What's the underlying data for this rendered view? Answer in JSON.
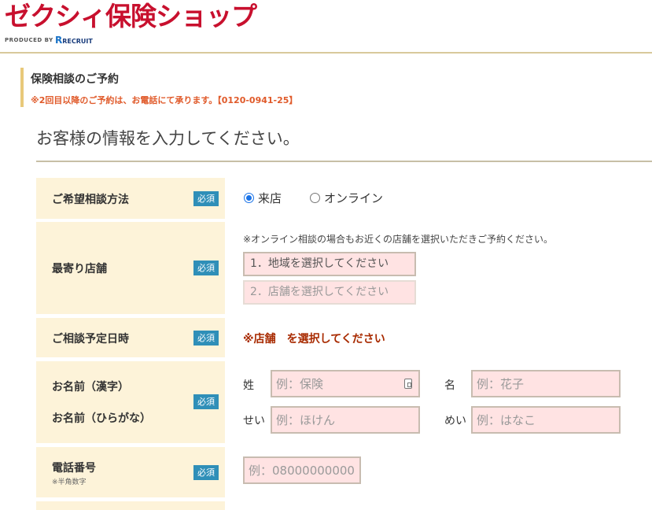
{
  "header": {
    "logo_text": "ゼクシィ保険ショップ",
    "produced_by": "PRODUCED BY",
    "recruit_mark": "R",
    "recruit_text": "RECRUIT"
  },
  "notice": {
    "title": "保険相談のご予約",
    "subtitle": "※2回目以降のご予約は、お電話にて承ります。【0120-0941-25】"
  },
  "section": {
    "title": "お客様の情報を入力してください。"
  },
  "required_label": "必須",
  "form": {
    "method": {
      "label": "ご希望相談方法",
      "options": [
        "来店",
        "オンライン"
      ],
      "selected": "来店"
    },
    "store": {
      "label": "最寄り店舗",
      "note": "※オンライン相談の場合もお近くの店舗を選択いただきご予約ください。",
      "area_select": "1．地域を選択してください",
      "store_select": "2．店舗を選択してください"
    },
    "datetime": {
      "label": "ご相談予定日時",
      "warning": "※店舗　を選択してください"
    },
    "name": {
      "label_kanji": "お名前（漢字）",
      "label_kana": "お名前（ひらがな）",
      "sei_label": "姓",
      "sei_placeholder": "例：保険",
      "mei_label": "名",
      "mei_placeholder": "例：花子",
      "sei_kana_label": "せい",
      "sei_kana_placeholder": "例：ほけん",
      "mei_kana_label": "めい",
      "mei_kana_placeholder": "例：はなこ"
    },
    "phone": {
      "label": "電話番号",
      "hint": "※半角数字",
      "placeholder": "例：08000000000"
    }
  },
  "colors": {
    "brand": "#c8102e",
    "label_bg": "#fdf3d9",
    "required_badge": "#2f8fb8",
    "input_bg": "#ffe3e3",
    "notice_text": "#e05a2a",
    "warning_text": "#a82a00"
  }
}
